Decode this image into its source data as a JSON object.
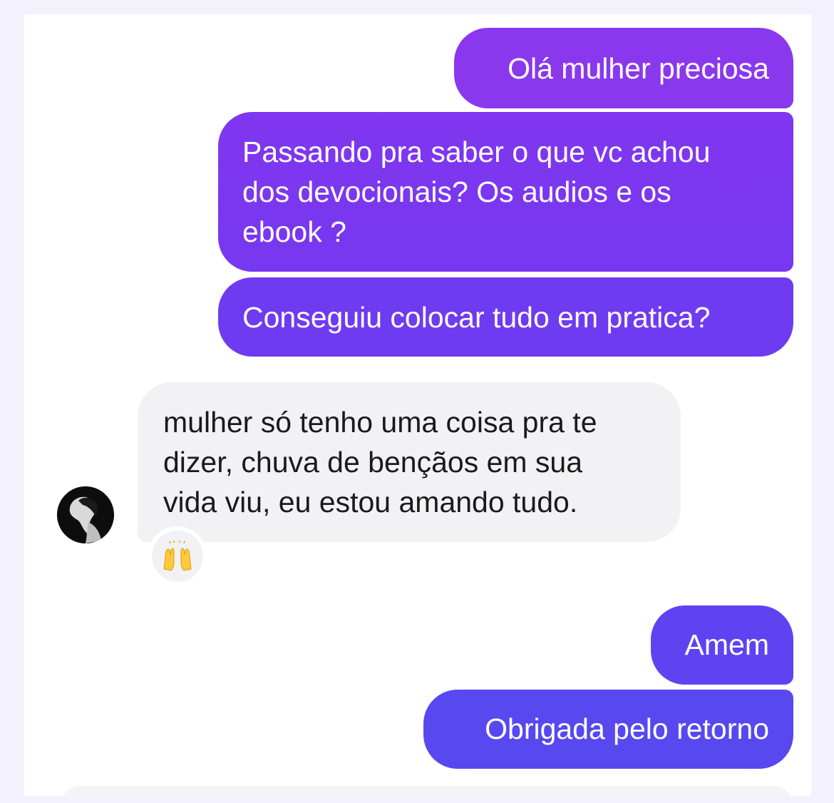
{
  "conversation": {
    "messages": [
      {
        "direction": "outgoing",
        "lines": [
          "Olá mulher preciosa"
        ]
      },
      {
        "direction": "outgoing",
        "lines": [
          "Passando pra saber o que vc achou",
          "dos devocionais? Os audios e os",
          "ebook ?"
        ]
      },
      {
        "direction": "outgoing",
        "lines": [
          "Conseguiu colocar tudo em pratica?"
        ]
      },
      {
        "direction": "incoming",
        "lines": [
          "mulher só tenho uma coisa pra te",
          "dizer, chuva de bençãos em sua",
          "vida viu, eu estou amando tudo."
        ],
        "reaction": "raising-hands-emoji"
      },
      {
        "direction": "outgoing",
        "lines": [
          "Amem"
        ]
      },
      {
        "direction": "outgoing",
        "lines": [
          "Obrigada pelo retorno"
        ]
      }
    ]
  },
  "colors": {
    "page_background": "#f3f1fb",
    "outgoing_gradient_top": "#8a38ee",
    "outgoing_gradient_bottom": "#5848f0",
    "incoming_bubble": "#f2f2f4",
    "incoming_text": "#1a1a1a"
  }
}
